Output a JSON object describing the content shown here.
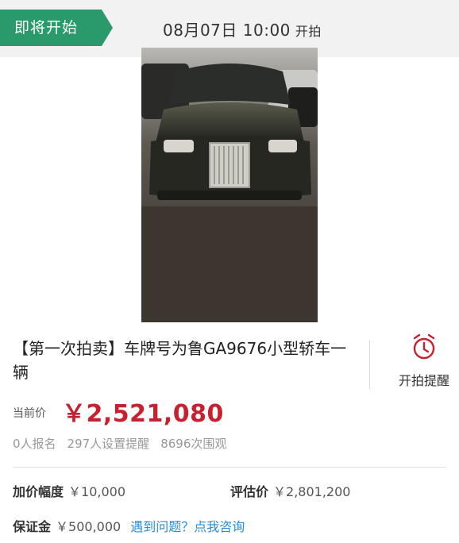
{
  "header": {
    "status_label": "即将开始",
    "start_time": "08月07日 10:00",
    "start_suffix": "开拍",
    "status_color": "#2a9a6a"
  },
  "item": {
    "photo_icon": "car-photo",
    "title": "【第一次拍卖】车牌号为鲁GA9676小型轿车一辆",
    "remind_label": "开拍提醒",
    "remind_icon": "alarm-clock-icon"
  },
  "price": {
    "label": "当前价",
    "value": "￥2,521,080",
    "color": "#c8202f"
  },
  "stats": {
    "signups": "0人报名",
    "reminders": "297人设置提醒",
    "views": "8696次围观"
  },
  "details": {
    "increment_label": "加价幅度",
    "increment_value": "￥10,000",
    "appraisal_label": "评估价",
    "appraisal_value": "￥2,801,200",
    "deposit_label": "保证金",
    "deposit_value": "￥500,000",
    "help_link": "遇到问题？点我咨询"
  }
}
